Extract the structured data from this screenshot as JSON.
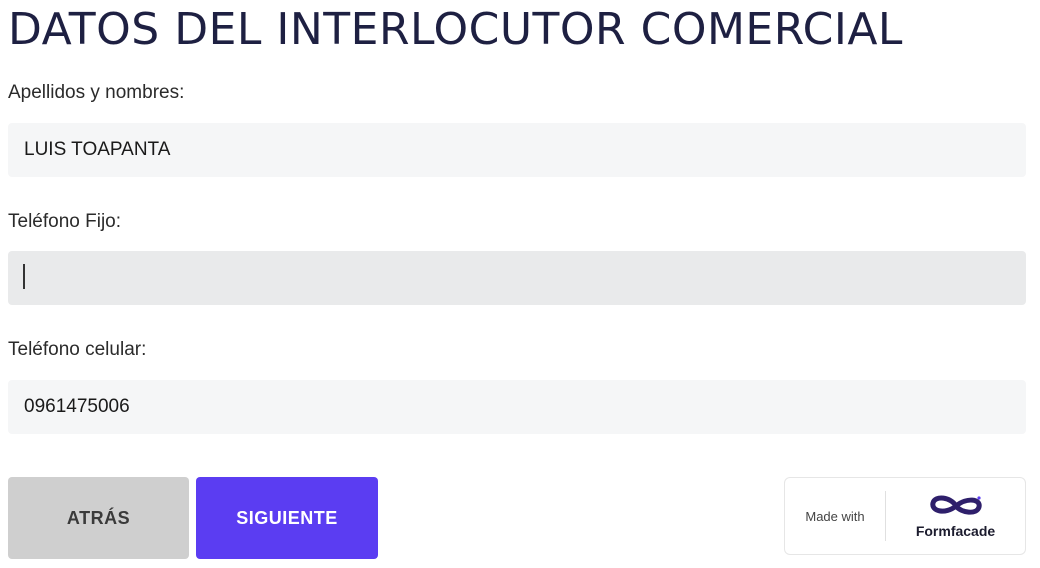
{
  "page": {
    "title": "DATOS DEL INTERLOCUTOR COMERCIAL"
  },
  "fields": {
    "name": {
      "label": "Apellidos y nombres:",
      "value": "LUIS TOAPANTA"
    },
    "landline": {
      "label": "Teléfono Fijo:",
      "value": ""
    },
    "mobile": {
      "label": "Teléfono celular:",
      "value": "0961475006"
    }
  },
  "buttons": {
    "back_label": "ATRÁS",
    "next_label": "SIGUIENTE"
  },
  "badge": {
    "made_with": "Made with",
    "brand": "Formfacade",
    "logo_icon": "infinity-logo-icon"
  },
  "colors": {
    "accent": "#5b3df2",
    "back_button": "#cfcfcf",
    "title": "#1e2042"
  }
}
